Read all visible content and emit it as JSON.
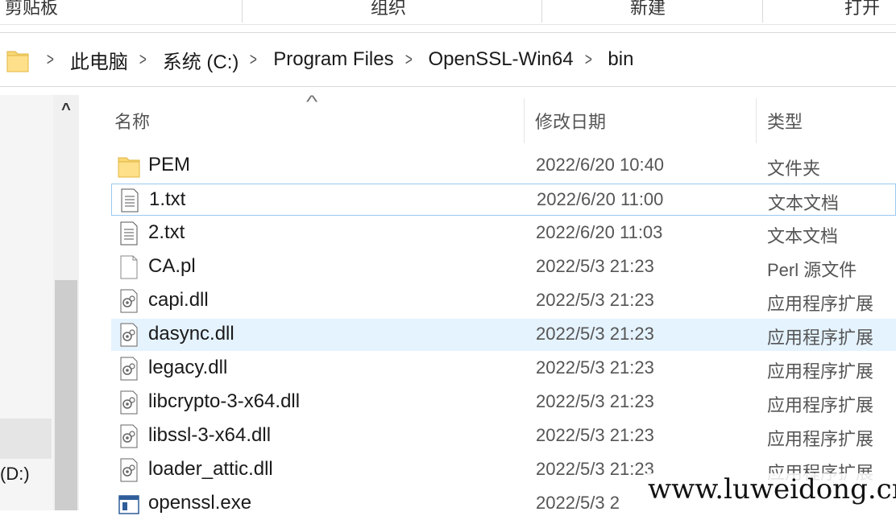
{
  "ribbon": {
    "groups": [
      "剪贴板",
      "组织",
      "新建",
      "打开"
    ]
  },
  "address_bar": {
    "crumbs": [
      "此电脑",
      "系统 (C:)",
      "Program Files",
      "OpenSSL-Win64",
      "bin"
    ]
  },
  "nav_pane": {
    "drive_label": "(D:)"
  },
  "columns": {
    "name": "名称",
    "date": "修改日期",
    "type": "类型"
  },
  "files": [
    {
      "name": "PEM",
      "date": "2022/6/20 10:40",
      "type": "文件夹",
      "icon": "folder-icon"
    },
    {
      "name": "1.txt",
      "date": "2022/6/20 11:00",
      "type": "文本文档",
      "icon": "text-file-icon"
    },
    {
      "name": "2.txt",
      "date": "2022/6/20 11:03",
      "type": "文本文档",
      "icon": "text-file-icon"
    },
    {
      "name": "CA.pl",
      "date": "2022/5/3 21:23",
      "type": "Perl 源文件",
      "icon": "generic-file-icon"
    },
    {
      "name": "capi.dll",
      "date": "2022/5/3 21:23",
      "type": "应用程序扩展",
      "icon": "dll-file-icon"
    },
    {
      "name": "dasync.dll",
      "date": "2022/5/3 21:23",
      "type": "应用程序扩展",
      "icon": "dll-file-icon"
    },
    {
      "name": "legacy.dll",
      "date": "2022/5/3 21:23",
      "type": "应用程序扩展",
      "icon": "dll-file-icon"
    },
    {
      "name": "libcrypto-3-x64.dll",
      "date": "2022/5/3 21:23",
      "type": "应用程序扩展",
      "icon": "dll-file-icon"
    },
    {
      "name": "libssl-3-x64.dll",
      "date": "2022/5/3 21:23",
      "type": "应用程序扩展",
      "icon": "dll-file-icon"
    },
    {
      "name": "loader_attic.dll",
      "date": "2022/5/3 21:23",
      "type": "应用程序扩展",
      "icon": "dll-file-icon"
    },
    {
      "name": "openssl.exe",
      "date": "2022/5/3 2",
      "type": "",
      "icon": "exe-file-icon"
    }
  ],
  "watermark": "www.luweidong.cn",
  "colors": {
    "hover_row": "#e5f3ff",
    "focus_border": "#99c9ef",
    "folder_yellow": "#f8d775"
  }
}
